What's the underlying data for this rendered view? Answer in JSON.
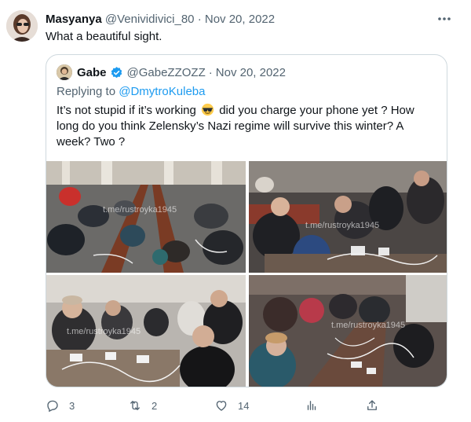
{
  "tweet": {
    "author_name": "Masyanya",
    "author_handle": "@Venividivici_80",
    "separator": "·",
    "date": "Nov 20, 2022",
    "text": "What a beautiful sight."
  },
  "quote": {
    "author_name": "Gabe",
    "author_handle": "@GabeZZOZZ",
    "separator": "·",
    "date": "Nov 20, 2022",
    "reply_prefix": "Replying to",
    "reply_mention": "@DmytroKuleba",
    "text_before_emoji": "It’s not stupid if it’s working",
    "emoji": "smiling-face-with-sunglasses",
    "text_after_emoji": "did you charge your phone yet ? How long do you think Zelensky’s Nazi regime will survive this winter? A week? Two ?",
    "photos": [
      {
        "watermark": "t.me/rustroyka1945"
      },
      {
        "watermark": "t.me/rustroyka1945"
      },
      {
        "watermark": "t.me/rustroyka1945"
      },
      {
        "watermark": "t.me/rustroyka1945"
      }
    ]
  },
  "actions": {
    "replies": "3",
    "retweets": "2",
    "likes": "14",
    "views": "",
    "share": ""
  },
  "colors": {
    "text": "#0f1419",
    "muted": "#536471",
    "link": "#1d9bf0",
    "border": "#cfd9de",
    "verified": "#1d9bf0"
  }
}
